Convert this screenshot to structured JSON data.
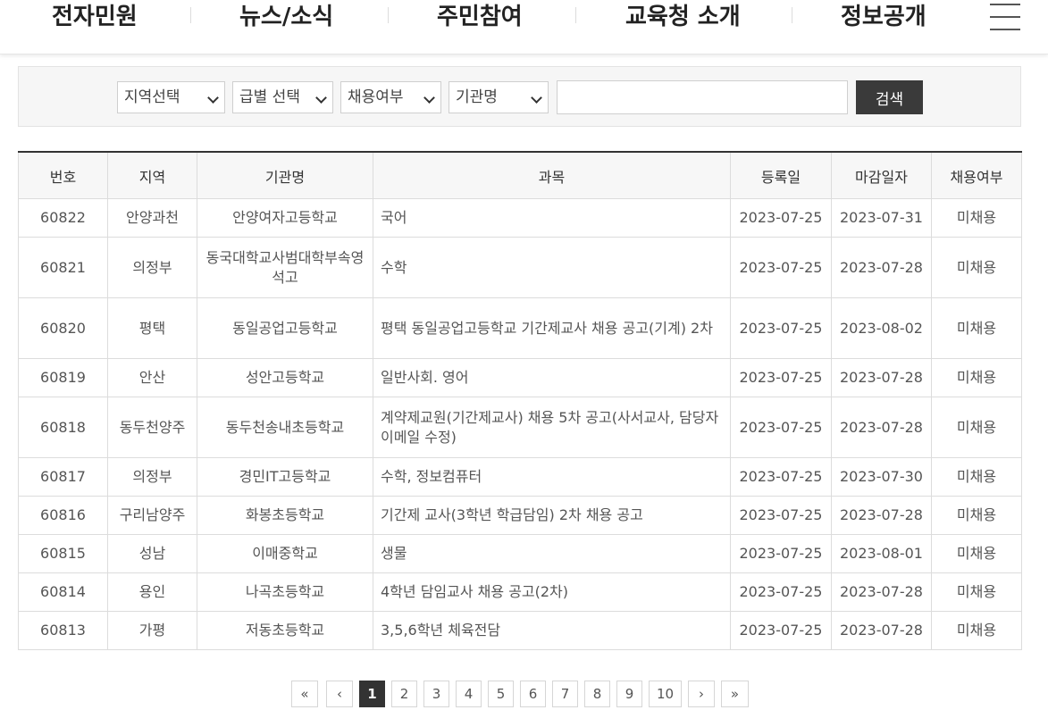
{
  "nav": {
    "items": [
      "전자민원",
      "뉴스/소식",
      "주민참여",
      "교육청 소개",
      "정보공개"
    ]
  },
  "search": {
    "region_select": "지역선택",
    "grade_select": "급별 선택",
    "hire_select": "채용여부",
    "org_select": "기관명",
    "keyword_value": "",
    "button_label": "검색"
  },
  "table": {
    "headers": [
      "번호",
      "지역",
      "기관명",
      "과목",
      "등록일",
      "마감일자",
      "채용여부"
    ],
    "rows": [
      {
        "no": "60822",
        "region": "안양과천",
        "org": "안양여자고등학교",
        "subject": "국어",
        "reg": "2023-07-25",
        "deadline": "2023-07-31",
        "status": "미채용"
      },
      {
        "no": "60821",
        "region": "의정부",
        "org": "동국대학교사범대학부속영석고",
        "subject": "수학",
        "reg": "2023-07-25",
        "deadline": "2023-07-28",
        "status": "미채용"
      },
      {
        "no": "60820",
        "region": "평택",
        "org": "동일공업고등학교",
        "subject": "평택 동일공업고등학교 기간제교사 채용 공고(기계) 2차",
        "reg": "2023-07-25",
        "deadline": "2023-08-02",
        "status": "미채용"
      },
      {
        "no": "60819",
        "region": "안산",
        "org": "성안고등학교",
        "subject": "일반사회. 영어",
        "reg": "2023-07-25",
        "deadline": "2023-07-28",
        "status": "미채용"
      },
      {
        "no": "60818",
        "region": "동두천양주",
        "org": "동두천송내초등학교",
        "subject": "계약제교원(기간제교사) 채용 5차 공고(사서교사, 담당자 이메일 수정)",
        "reg": "2023-07-25",
        "deadline": "2023-07-28",
        "status": "미채용"
      },
      {
        "no": "60817",
        "region": "의정부",
        "org": "경민IT고등학교",
        "subject": "수학, 정보컴퓨터",
        "reg": "2023-07-25",
        "deadline": "2023-07-30",
        "status": "미채용"
      },
      {
        "no": "60816",
        "region": "구리남양주",
        "org": "화봉초등학교",
        "subject": "기간제 교사(3학년 학급담임) 2차 채용 공고",
        "reg": "2023-07-25",
        "deadline": "2023-07-28",
        "status": "미채용"
      },
      {
        "no": "60815",
        "region": "성남",
        "org": "이매중학교",
        "subject": "생물",
        "reg": "2023-07-25",
        "deadline": "2023-08-01",
        "status": "미채용"
      },
      {
        "no": "60814",
        "region": "용인",
        "org": "나곡초등학교",
        "subject": "4학년 담임교사 채용 공고(2차)",
        "reg": "2023-07-25",
        "deadline": "2023-07-28",
        "status": "미채용"
      },
      {
        "no": "60813",
        "region": "가평",
        "org": "저동초등학교",
        "subject": "3,5,6학년 체육전담",
        "reg": "2023-07-25",
        "deadline": "2023-07-28",
        "status": "미채용"
      }
    ]
  },
  "pagination": {
    "first": "«",
    "prev": "‹",
    "pages": [
      "1",
      "2",
      "3",
      "4",
      "5",
      "6",
      "7",
      "8",
      "9",
      "10"
    ],
    "current": "1",
    "next": "›",
    "last": "»"
  }
}
